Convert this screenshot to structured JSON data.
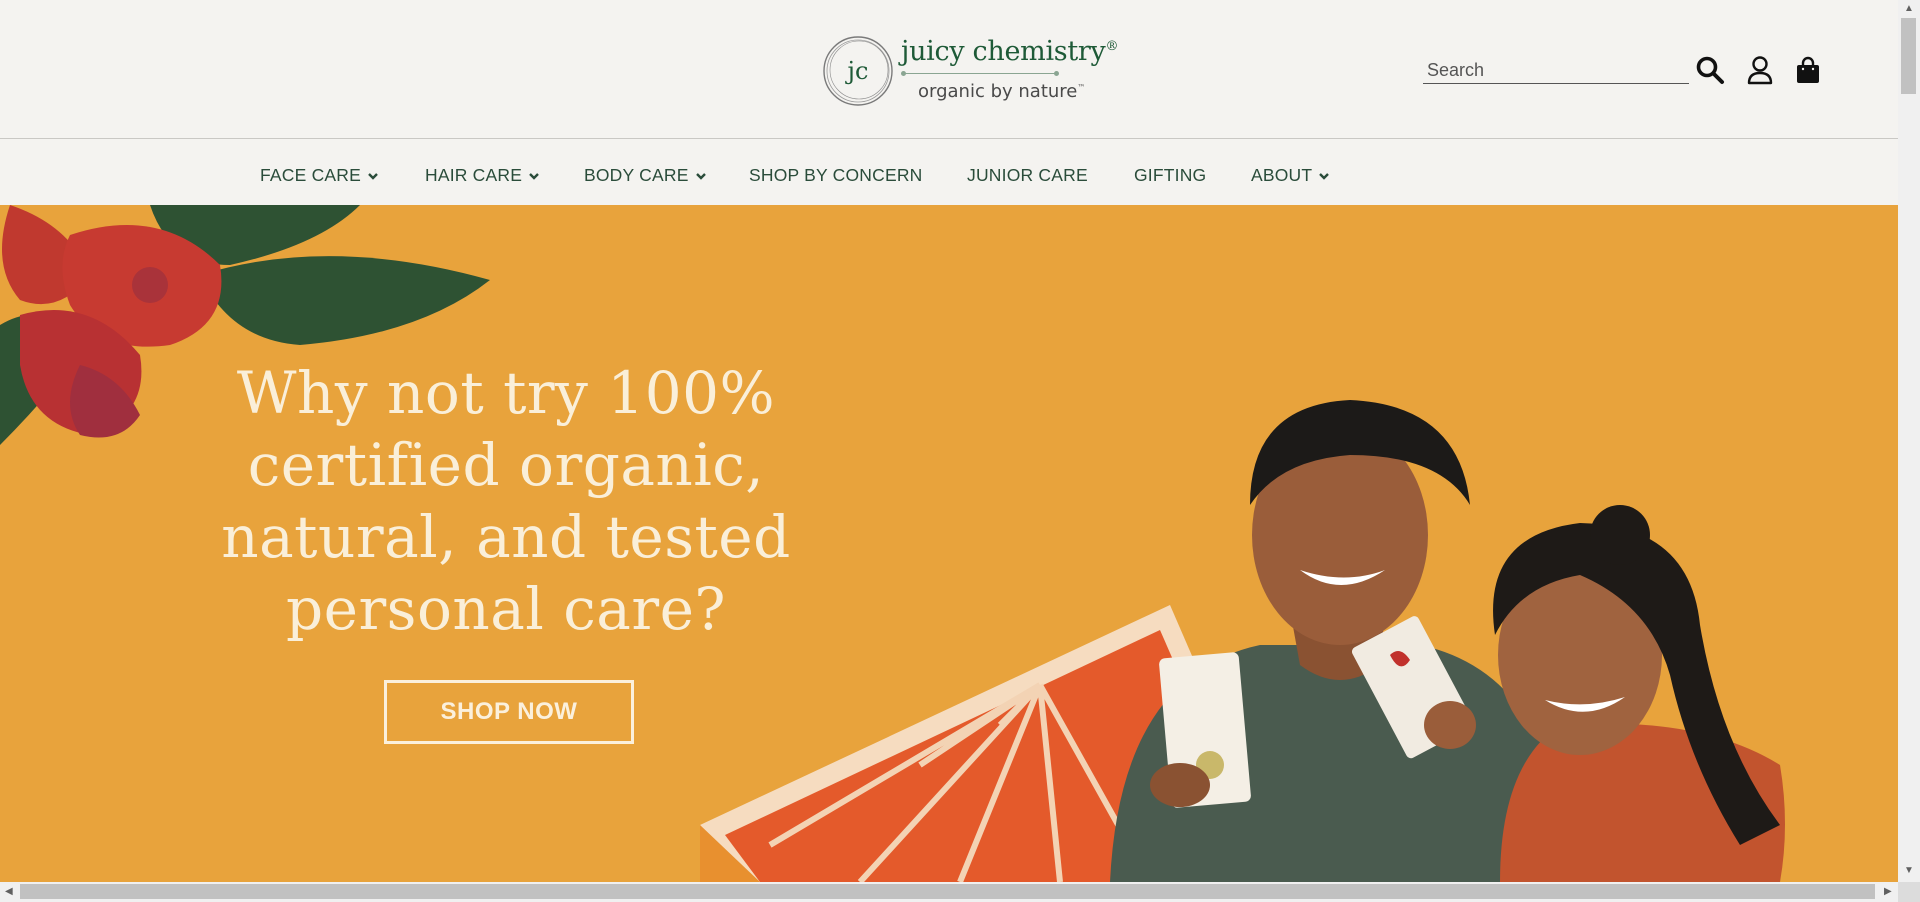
{
  "logo": {
    "monogram": "jc",
    "name": "juicy chemistry",
    "registered": "®",
    "tagline": "organic by nature",
    "trademark": "™"
  },
  "search": {
    "placeholder": "Search",
    "value": ""
  },
  "header_icons": [
    "search-icon",
    "user-icon",
    "shopping-bag-icon"
  ],
  "nav": {
    "items": [
      {
        "label": "FACE CARE",
        "dropdown": true
      },
      {
        "label": "HAIR CARE",
        "dropdown": true
      },
      {
        "label": "BODY CARE",
        "dropdown": true
      },
      {
        "label": "SHOP BY CONCERN",
        "dropdown": false
      },
      {
        "label": "JUNIOR CARE",
        "dropdown": false
      },
      {
        "label": "GIFTING",
        "dropdown": false
      },
      {
        "label": "ABOUT",
        "dropdown": true
      }
    ]
  },
  "hero": {
    "headline_lines": [
      "Why not try 100%",
      "certified organic,",
      "natural, and tested",
      "personal care?"
    ],
    "cta_label": "SHOP NOW"
  },
  "colors": {
    "header_bg": "#f4f3f0",
    "brand_green": "#1e5a37",
    "nav_text": "#2a4c3a",
    "hero_bg": "#e8a33c",
    "hero_text": "#faefd9"
  }
}
